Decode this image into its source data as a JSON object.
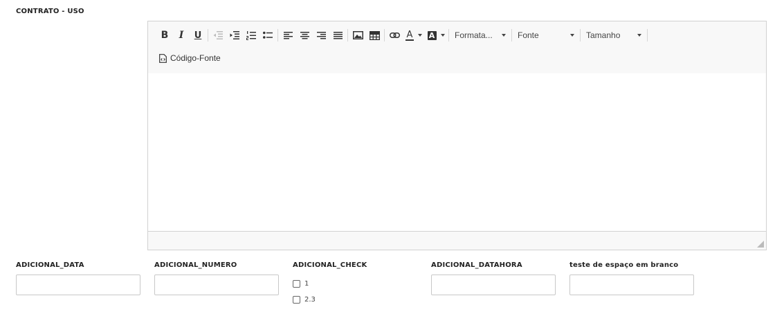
{
  "section": {
    "title": "CONTRATO - USO"
  },
  "editor": {
    "toolbar": {
      "bold": "B",
      "italic": "I",
      "underline": "U",
      "format_dropdown": "Formata...",
      "font_dropdown": "Fonte",
      "size_dropdown": "Tamanho",
      "source_code": "Código-Fonte",
      "text_color_glyph": "A",
      "bg_color_glyph": "A"
    }
  },
  "fields": {
    "adicional_data": {
      "label": "ADICIONAL_DATA",
      "value": ""
    },
    "adicional_numero": {
      "label": "ADICIONAL_NUMERO",
      "value": ""
    },
    "adicional_check": {
      "label": "ADICIONAL_CHECK",
      "options": [
        {
          "label": "1",
          "checked": false
        },
        {
          "label": "2.3",
          "checked": false
        }
      ]
    },
    "adicional_datahora": {
      "label": "ADICIONAL_DATAHORA",
      "value": ""
    },
    "teste_espaco": {
      "label": "teste de espaço em branco",
      "value": ""
    }
  }
}
